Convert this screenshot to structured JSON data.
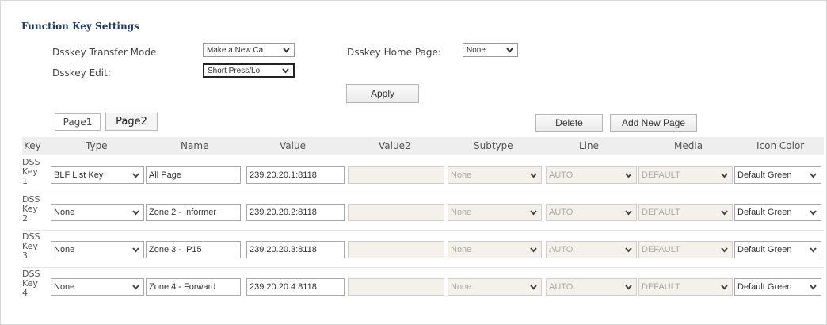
{
  "title": "Function Key Settings",
  "settings": {
    "transfer_mode_label": "Dsskey Transfer Mode",
    "transfer_mode_value": "Make a New Ca",
    "home_page_label": "Dsskey Home Page:",
    "home_page_value": "None",
    "edit_label": "Dsskey Edit:",
    "edit_value": "Short Press/Lo",
    "apply_label": "Apply"
  },
  "pages": {
    "page1": "Page1",
    "page2": "Page2",
    "delete": "Delete",
    "add_new_page": "Add New Page"
  },
  "columns": [
    "Key",
    "Type",
    "Name",
    "Value",
    "Value2",
    "Subtype",
    "Line",
    "Media",
    "Icon Color"
  ],
  "rows": [
    {
      "key": [
        "DSS",
        "Key",
        "1"
      ],
      "type": "BLF List Key",
      "name": "All Page",
      "value": "239.20.20.1:8118",
      "value2": "",
      "subtype": "None",
      "line": "AUTO",
      "media": "DEFAULT",
      "icon_color": "Default Green"
    },
    {
      "key": [
        "DSS",
        "Key",
        "2"
      ],
      "type": "None",
      "name": "Zone 2 - Informer",
      "value": "239.20.20.2:8118",
      "value2": "",
      "subtype": "None",
      "line": "AUTO",
      "media": "DEFAULT",
      "icon_color": "Default Green"
    },
    {
      "key": [
        "DSS",
        "Key",
        "3"
      ],
      "type": "None",
      "name": "Zone 3 - IP15",
      "value": "239.20.20.3:8118",
      "value2": "",
      "subtype": "None",
      "line": "AUTO",
      "media": "DEFAULT",
      "icon_color": "Default Green"
    },
    {
      "key": [
        "DSS",
        "Key",
        "4"
      ],
      "type": "None",
      "name": "Zone 4 - Forward",
      "value": "239.20.20.4:8118",
      "value2": "",
      "subtype": "None",
      "line": "AUTO",
      "media": "DEFAULT",
      "icon_color": "Default Green"
    }
  ]
}
